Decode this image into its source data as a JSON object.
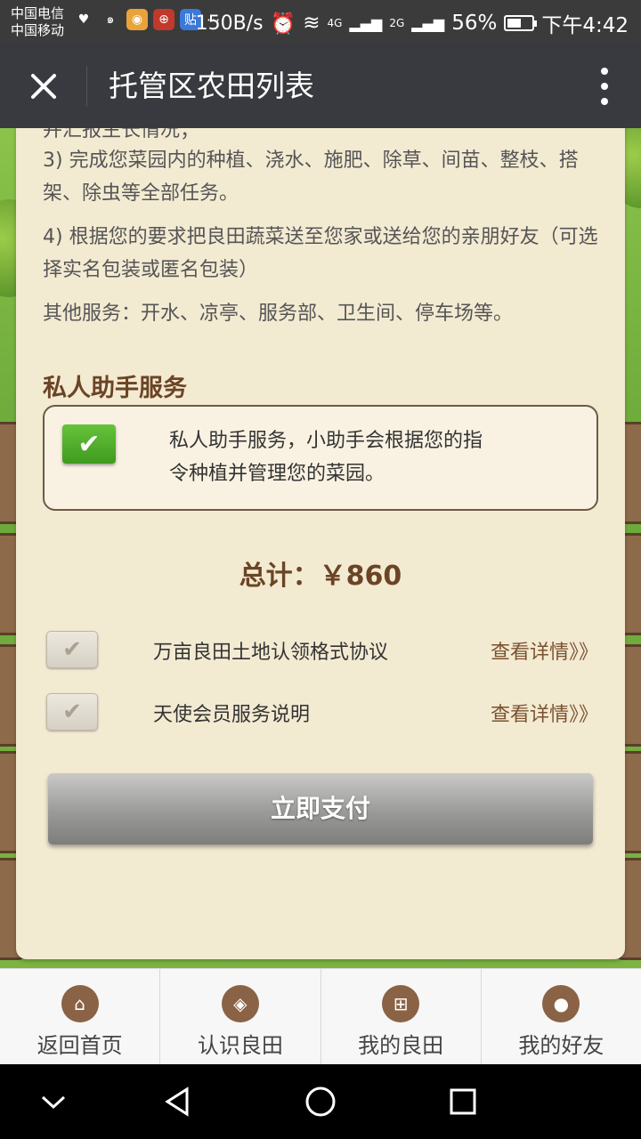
{
  "status_bar": {
    "carrier1": "中国电信",
    "carrier2": "中国移动",
    "net_speed": "150B/s",
    "signal1": "4G",
    "signal2": "2G",
    "battery": "56%",
    "battery_level": 0.56,
    "time": "下午4:42",
    "app_icon_tieba": "贴",
    "more": "···"
  },
  "navbar": {
    "title": "托管区农田列表"
  },
  "content": {
    "cut_line": "并汇报生长情况；",
    "item3": "3) 完成您菜园内的种植、浇水、施肥、除草、间苗、整枝、搭架、除虫等全部任务。",
    "item4": "4) 根据您的要求把良田蔬菜送至您家或送给您的亲朋好友（可选择实名包装或匿名包装）",
    "other": "其他服务：开水、凉亭、服务部、卫生间、停车场等。",
    "section_title": "私人助手服务",
    "service_desc": "私人助手服务，小助手会根据您的指令种植并管理您的菜园。",
    "total_label": "总计：",
    "total_value": "￥860",
    "agreements": [
      {
        "label": "万亩良田土地认领格式协议",
        "link": "查看详情》》"
      },
      {
        "label": "天使会员服务说明",
        "link": "查看详情》》"
      }
    ],
    "pay_button": "立即支付"
  },
  "tabbar": {
    "tabs": [
      {
        "label": "返回首页",
        "icon": "home-icon"
      },
      {
        "label": "认识良田",
        "icon": "tag-icon"
      },
      {
        "label": "我的良田",
        "icon": "grid-icon"
      },
      {
        "label": "我的好友",
        "icon": "user-icon"
      }
    ]
  },
  "colors": {
    "panel_bg": "#f3ead2",
    "accent_brown": "#6b4426",
    "tab_icon_bg": "#8a6245",
    "check_green": "#4fb02a",
    "navbar_bg": "#393a3f"
  }
}
